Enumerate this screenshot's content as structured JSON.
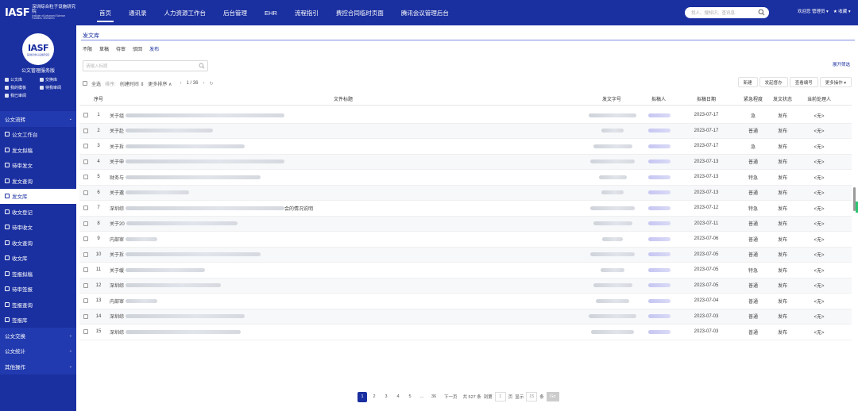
{
  "brand": {
    "mark": "IASF",
    "name_cn": "深圳综合粒子设施研究院",
    "name_en": "Institute of Advanced Science Facilities, Shenzhen"
  },
  "nav": [
    "首页",
    "通讯录",
    "人力资源工作台",
    "后台管理",
    "EHR",
    "流程指引",
    "费控合同临时页面",
    "腾讯会议管理后台"
  ],
  "top": {
    "search_placeholder": "找人、搜知识、查讯息",
    "welcome": "欢迎您 管理员 ▾",
    "fav": "★ 收藏 ▾"
  },
  "sidebar": {
    "system_name": "公文管理服务版",
    "avatar_sub": "深圳综合粒子设施研究院",
    "quick": [
      "公文库",
      "交换库",
      "我的模板",
      "待我审阅",
      "我已审阅"
    ],
    "items": [
      {
        "label": "公文流转",
        "type": "group"
      },
      {
        "label": "公文工作台",
        "type": "item"
      },
      {
        "label": "发文拟稿",
        "type": "item"
      },
      {
        "label": "待审发文",
        "type": "item"
      },
      {
        "label": "发文查询",
        "type": "item"
      },
      {
        "label": "发文库",
        "type": "active"
      },
      {
        "label": "收文登记",
        "type": "item"
      },
      {
        "label": "待审收文",
        "type": "item"
      },
      {
        "label": "收文查询",
        "type": "item"
      },
      {
        "label": "收文库",
        "type": "item"
      },
      {
        "label": "签报拟稿",
        "type": "item"
      },
      {
        "label": "待审签报",
        "type": "item"
      },
      {
        "label": "签报查询",
        "type": "item"
      },
      {
        "label": "签报库",
        "type": "item"
      },
      {
        "label": "公文交换",
        "type": "group"
      },
      {
        "label": "公文统计",
        "type": "group"
      },
      {
        "label": "其他操作",
        "type": "group"
      }
    ]
  },
  "main": {
    "title": "发文库",
    "filters": [
      "不限",
      "草稿",
      "待审",
      "驳回",
      "发布"
    ],
    "search_placeholder": "请输入标题",
    "advanced": "展开筛选",
    "toolbar": {
      "select_all": "全选",
      "sort_label": "排序:",
      "sort_field": "创建时间 ⇕",
      "more_sort": "更多排序 ∧",
      "page_info": "1 / 36",
      "buttons": [
        "新建",
        "发起督办",
        "查看编号",
        "更多操作 ▾"
      ]
    },
    "columns": [
      "序号",
      "文件标题",
      "发文字号",
      "拟稿人",
      "拟稿日期",
      "紧急程度",
      "发文状态",
      "当前处理人"
    ],
    "rows": [
      {
        "no": "1",
        "prefix": "关于组",
        "suffix": "",
        "w": 200,
        "date": "2023-07-17",
        "urgency": "急",
        "status": "发布",
        "handler": "<无>"
      },
      {
        "no": "2",
        "prefix": "关于赴",
        "suffix": "",
        "w": 110,
        "date": "2023-07-17",
        "urgency": "普通",
        "status": "发布",
        "handler": "<无>"
      },
      {
        "no": "3",
        "prefix": "关于拆",
        "suffix": "",
        "w": 150,
        "date": "2023-07-17",
        "urgency": "急",
        "status": "发布",
        "handler": "<无>"
      },
      {
        "no": "4",
        "prefix": "关于申",
        "suffix": "",
        "w": 200,
        "date": "2023-07-13",
        "urgency": "普通",
        "status": "发布",
        "handler": "<无>"
      },
      {
        "no": "5",
        "prefix": "财务与",
        "suffix": "",
        "w": 170,
        "date": "2023-07-13",
        "urgency": "特急",
        "status": "发布",
        "handler": "<无>"
      },
      {
        "no": "6",
        "prefix": "关于邀",
        "suffix": "",
        "w": 80,
        "date": "2023-07-13",
        "urgency": "普通",
        "status": "发布",
        "handler": "<无>"
      },
      {
        "no": "7",
        "prefix": "深圳综",
        "suffix": "会的情况说明",
        "w": 200,
        "date": "2023-07-12",
        "urgency": "特急",
        "status": "发布",
        "handler": "<无>"
      },
      {
        "no": "8",
        "prefix": "关于20",
        "suffix": "",
        "w": 140,
        "date": "2023-07-11",
        "urgency": "普通",
        "status": "发布",
        "handler": "<无>"
      },
      {
        "no": "9",
        "prefix": "内部审",
        "suffix": "",
        "w": 40,
        "date": "2023-07-06",
        "urgency": "普通",
        "status": "发布",
        "handler": "<无>"
      },
      {
        "no": "10",
        "prefix": "关于拆",
        "suffix": "",
        "w": 170,
        "date": "2023-07-05",
        "urgency": "普通",
        "status": "发布",
        "handler": "<无>"
      },
      {
        "no": "11",
        "prefix": "关于缓",
        "suffix": "",
        "w": 100,
        "date": "2023-07-05",
        "urgency": "特急",
        "status": "发布",
        "handler": "<无>"
      },
      {
        "no": "12",
        "prefix": "深圳综",
        "suffix": "",
        "w": 120,
        "date": "2023-07-05",
        "urgency": "普通",
        "status": "发布",
        "handler": "<无>"
      },
      {
        "no": "13",
        "prefix": "内部审",
        "suffix": "",
        "w": 40,
        "date": "2023-07-04",
        "urgency": "普通",
        "status": "发布",
        "handler": "<无>"
      },
      {
        "no": "14",
        "prefix": "深圳综",
        "suffix": "",
        "w": 150,
        "date": "2023-07-03",
        "urgency": "普通",
        "status": "发布",
        "handler": "<无>"
      },
      {
        "no": "15",
        "prefix": "深圳综",
        "suffix": "",
        "w": 145,
        "date": "2023-07-03",
        "urgency": "普通",
        "status": "发布",
        "handler": "<无>"
      }
    ]
  },
  "pagination": {
    "pages": [
      "1",
      "2",
      "3",
      "4",
      "5",
      "...",
      "36"
    ],
    "next": "下一页",
    "total": "共 527 条",
    "goto": "到第",
    "goto_value": "1",
    "page_unit": "页",
    "show": "显示",
    "show_value": "15",
    "unit": "条",
    "go": "Go"
  }
}
